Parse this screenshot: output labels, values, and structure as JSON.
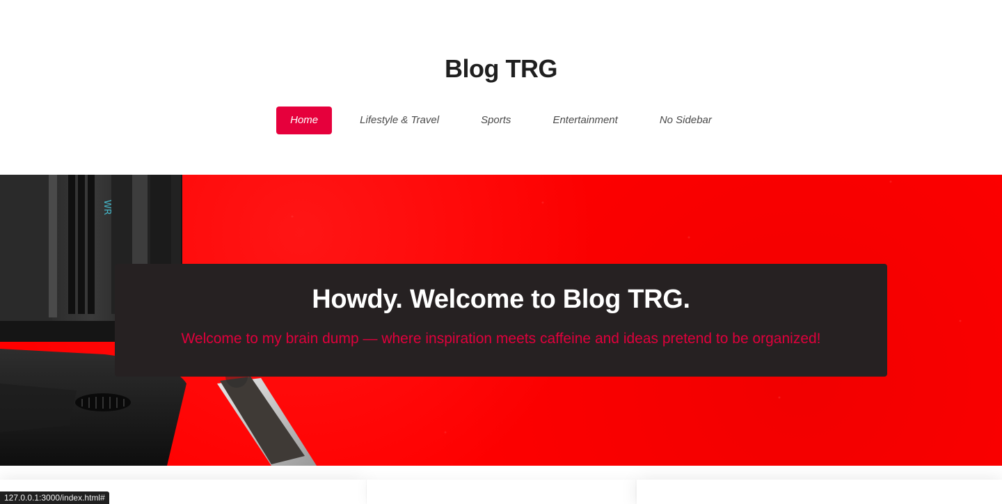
{
  "site": {
    "title": "Blog TRG"
  },
  "nav": {
    "items": [
      {
        "label": "Home",
        "active": true
      },
      {
        "label": "Lifestyle & Travel",
        "active": false
      },
      {
        "label": "Sports",
        "active": false
      },
      {
        "label": "Entertainment",
        "active": false
      },
      {
        "label": "No Sidebar",
        "active": false
      }
    ]
  },
  "hero": {
    "title": "Howdy. Welcome to Blog TRG.",
    "subtitle": "Welcome to my brain dump — where inspiration meets caffeine and ideas pretend to be organized!",
    "lens_text": "WR",
    "background_color": "#ff0000",
    "card_color": "#262122",
    "subtitle_color": "#e0003c"
  },
  "theme": {
    "accent": "#e6003c"
  },
  "status_bar": {
    "url": "127.0.0.1:3000/index.html#"
  }
}
